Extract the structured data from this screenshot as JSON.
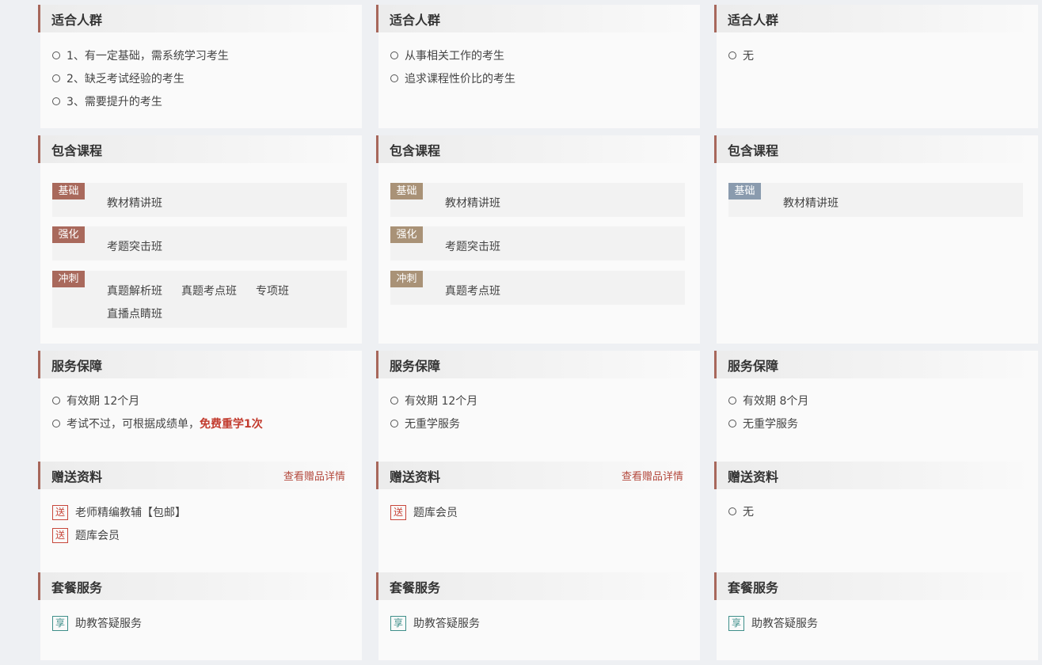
{
  "colors": {
    "accent": "#a7675b",
    "highlight": "#c23b2e",
    "tag_col1": "#a9695c",
    "tag_col2": "#a99277",
    "tag_col3": "#8a9bae",
    "gift_badge": "#c8473b",
    "share_badge": "#3f8f8a"
  },
  "columns": [
    {
      "audience": {
        "title": "适合人群",
        "items": [
          "1、有一定基础，需系统学习考生",
          "2、缺乏考试经验的考生",
          "3、需要提升的考生"
        ]
      },
      "courses": {
        "title": "包含课程",
        "rows": [
          {
            "tag": "基础",
            "items": [
              "教材精讲班"
            ]
          },
          {
            "tag": "强化",
            "items": [
              "考题突击班"
            ]
          },
          {
            "tag": "冲刺",
            "items": [
              "真题解析班",
              "真题考点班",
              "专项班",
              "直播点睛班"
            ]
          }
        ]
      },
      "service": {
        "title": "服务保障",
        "items": [
          "有效期 12个月",
          "考试不过，可根据成绩单，"
        ],
        "highlight": "免费重学1次"
      },
      "gifts": {
        "title": "赠送资料",
        "link": "查看赠品详情",
        "badge": "送",
        "items": [
          "老师精编教辅【包邮】",
          "题库会员"
        ]
      },
      "package": {
        "title": "套餐服务",
        "badge": "享",
        "items": [
          "助教答疑服务"
        ]
      }
    },
    {
      "audience": {
        "title": "适合人群",
        "items": [
          "从事相关工作的考生",
          "追求课程性价比的考生"
        ]
      },
      "courses": {
        "title": "包含课程",
        "rows": [
          {
            "tag": "基础",
            "items": [
              "教材精讲班"
            ]
          },
          {
            "tag": "强化",
            "items": [
              "考题突击班"
            ]
          },
          {
            "tag": "冲刺",
            "items": [
              "真题考点班"
            ]
          }
        ]
      },
      "service": {
        "title": "服务保障",
        "items": [
          "有效期 12个月",
          "无重学服务"
        ]
      },
      "gifts": {
        "title": "赠送资料",
        "link": "查看赠品详情",
        "badge": "送",
        "items": [
          "题库会员"
        ]
      },
      "package": {
        "title": "套餐服务",
        "badge": "享",
        "items": [
          "助教答疑服务"
        ]
      }
    },
    {
      "audience": {
        "title": "适合人群",
        "items": [
          "无"
        ]
      },
      "courses": {
        "title": "包含课程",
        "rows": [
          {
            "tag": "基础",
            "items": [
              "教材精讲班"
            ]
          }
        ]
      },
      "service": {
        "title": "服务保障",
        "items": [
          "有效期 8个月",
          "无重学服务"
        ]
      },
      "gifts": {
        "title": "赠送资料",
        "none": "无"
      },
      "package": {
        "title": "套餐服务",
        "badge": "享",
        "items": [
          "助教答疑服务"
        ]
      }
    }
  ]
}
